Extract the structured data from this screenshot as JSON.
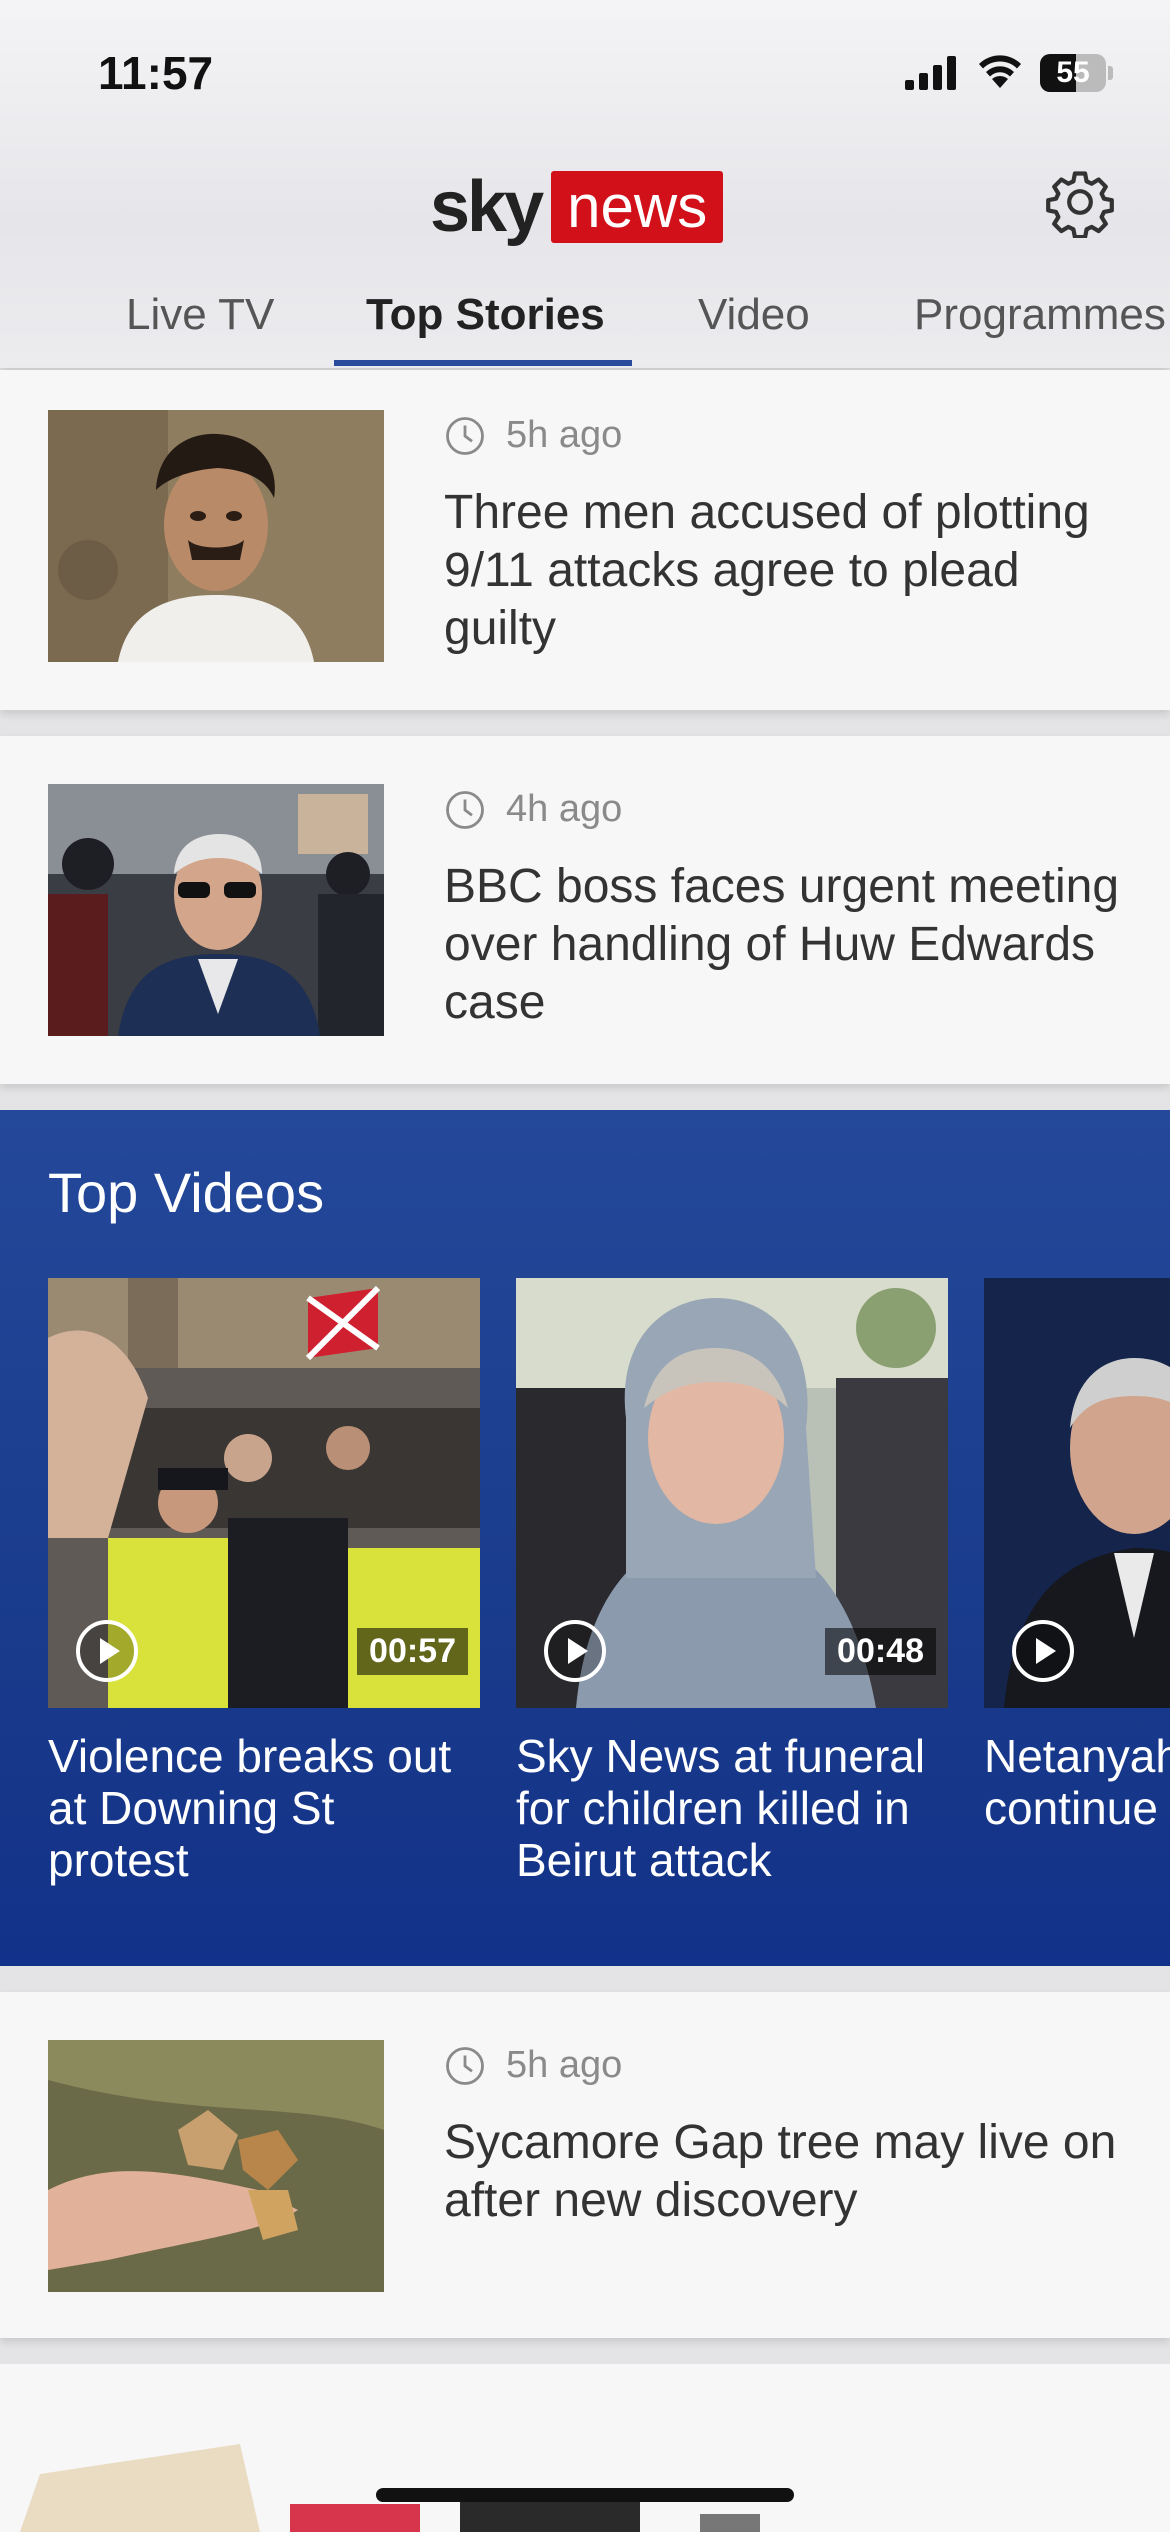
{
  "status_bar": {
    "time": "11:57",
    "battery": 55,
    "battery_label": "55"
  },
  "header": {
    "logo_sky": "sky",
    "logo_news": "news",
    "tabs": [
      {
        "label": "Live TV"
      },
      {
        "label": "Top Stories"
      },
      {
        "label": "Video"
      },
      {
        "label": "Programmes"
      }
    ],
    "active_tab": "Top Stories"
  },
  "stories": [
    {
      "time": "5h ago",
      "headline": "Three men accused of plotting 9/11 attacks agree to plead guilty"
    },
    {
      "time": "4h ago",
      "headline": "BBC boss faces urgent meeting over handling of Huw Edwards case"
    },
    {
      "time": "5h ago",
      "headline": "Sycamore Gap tree may live on after new discovery"
    }
  ],
  "top_videos": {
    "title": "Top Videos",
    "items": [
      {
        "duration": "00:57",
        "caption": "Violence breaks out at Downing St protest"
      },
      {
        "duration": "00:48",
        "caption": "Sky News at funeral for children killed in Beirut attack"
      },
      {
        "duration": "",
        "caption": "Netanyahu continue"
      }
    ]
  },
  "colors": {
    "accent": "#2a4a9c",
    "brand_red": "#d21019",
    "videos_bg": "#1a3b8b"
  }
}
